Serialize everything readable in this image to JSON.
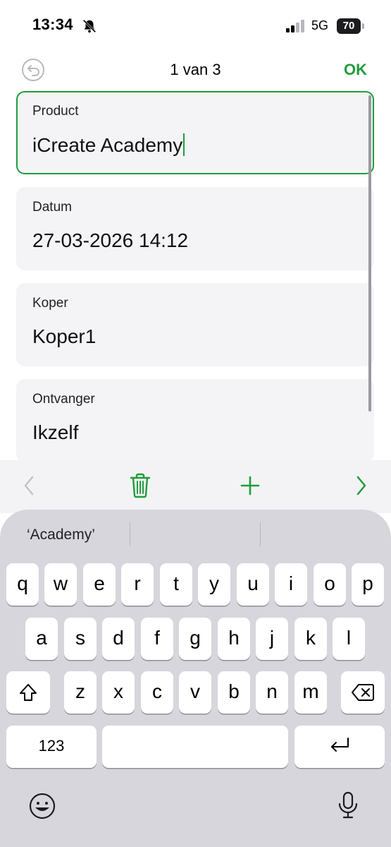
{
  "status_bar": {
    "time": "13:34",
    "network": "5G",
    "battery": "70",
    "icons": [
      "bell-slash-icon",
      "signal-bars-icon",
      "battery-icon"
    ]
  },
  "nav": {
    "title": "1 van 3",
    "ok_label": "OK",
    "undo_icon": "undo-icon"
  },
  "fields": [
    {
      "label": "Product",
      "value": "iCreate Academy",
      "active": true
    },
    {
      "label": "Datum",
      "value": "27-03-2026 14:12"
    },
    {
      "label": "Koper",
      "value": "Koper1"
    },
    {
      "label": "Ontvanger",
      "value": "Ikzelf"
    }
  ],
  "toolbar": {
    "icons": [
      "chevron-left-icon",
      "trash-icon",
      "plus-icon",
      "chevron-right-icon"
    ]
  },
  "keyboard": {
    "suggestions": [
      "‘Academy’",
      "",
      ""
    ],
    "row1": [
      "q",
      "w",
      "e",
      "r",
      "t",
      "y",
      "u",
      "i",
      "o",
      "p"
    ],
    "row2": [
      "a",
      "s",
      "d",
      "f",
      "g",
      "h",
      "j",
      "k",
      "l"
    ],
    "row3": [
      "z",
      "x",
      "c",
      "v",
      "b",
      "n",
      "m"
    ],
    "numbers_label": "123",
    "icons": [
      "shift-icon",
      "delete-icon",
      "return-icon",
      "emoji-icon",
      "microphone-icon"
    ]
  },
  "colors": {
    "accent": "#1f9d3a",
    "card_bg": "#f4f4f7",
    "keyboard_bg": "#d6d6dc"
  }
}
